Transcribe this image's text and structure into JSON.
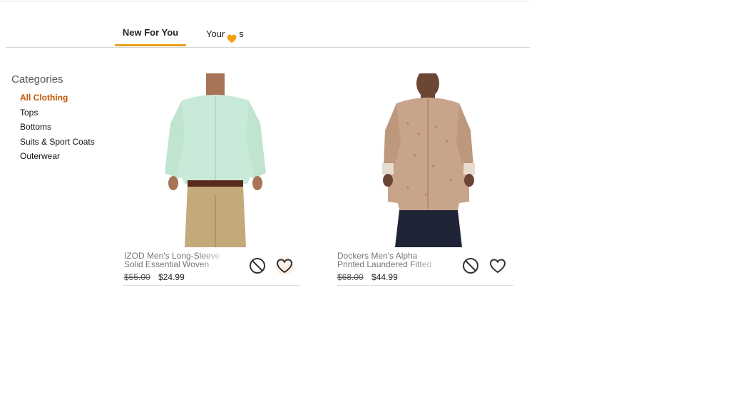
{
  "tabs": [
    {
      "label": "New For You",
      "active": true
    },
    {
      "label_prefix": "Your",
      "label_suffix": "s",
      "icon": "heart-icon",
      "active": false
    }
  ],
  "sidebar": {
    "title": "Categories",
    "items": [
      {
        "label": "All Clothing",
        "active": true
      },
      {
        "label": "Tops"
      },
      {
        "label": "Bottoms"
      },
      {
        "label": "Suits & Sport Coats"
      },
      {
        "label": "Outerwear"
      }
    ]
  },
  "products": [
    {
      "title": "IZOD Men's Long-Sleeve Solid Essential Woven",
      "list_price": "$55.00",
      "sale_price": "$24.99",
      "image": "mint-green-button-down-shirt-khaki-pants",
      "shirt_color": "#c9ead8",
      "pants_color": "#c4a97a",
      "favorited_highlight": true
    },
    {
      "title": "Dockers Men's Alpha Printed Laundered Fitted Long",
      "list_price": "$68.00",
      "sale_price": "$44.99",
      "image": "tan-printed-button-down-shirt-dark-jeans",
      "shirt_color": "#c8a48a",
      "pants_color": "#1f2436",
      "favorited_highlight": false
    }
  ],
  "colors": {
    "accent": "#f0a020",
    "category_active": "#c45500"
  }
}
